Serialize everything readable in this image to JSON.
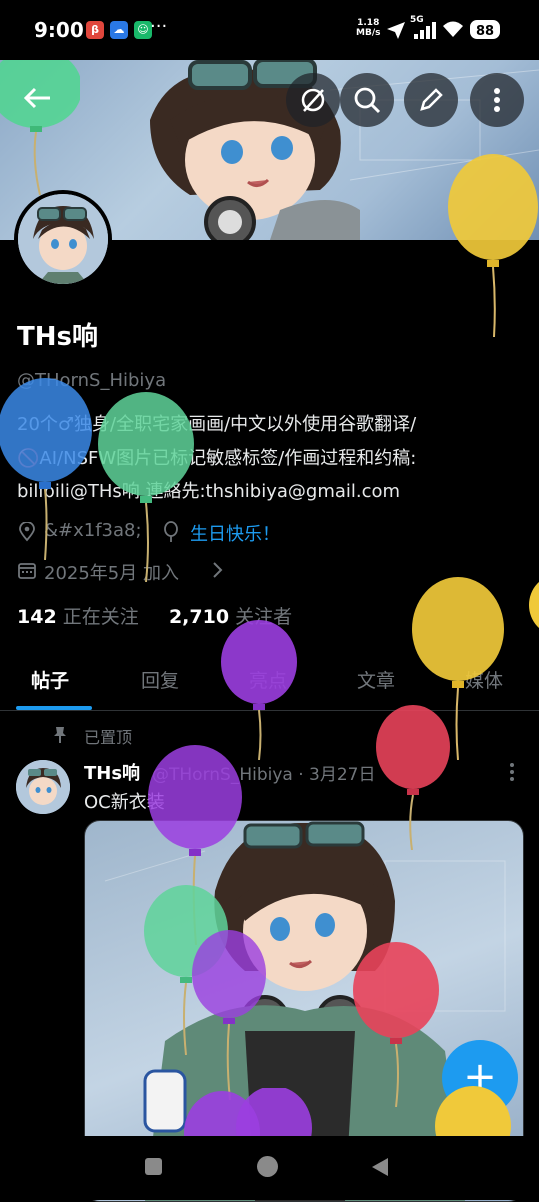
{
  "status_bar": {
    "time": "9:00",
    "apps": [
      "red-app",
      "cloud-app",
      "green-app"
    ],
    "more": "···",
    "net_speed_value": "1.18",
    "net_speed_unit": "MB/s",
    "network": "5G",
    "battery": "88"
  },
  "header": {
    "back_icon": "arrow-left-icon",
    "actions": [
      "grok-icon",
      "search-icon",
      "edit-icon",
      "more-vertical-icon"
    ]
  },
  "profile": {
    "display_name": "THs响",
    "handle": "@THornS_Hibiya",
    "bio_lines": [
      "20个♂独身/全职宅家画画/中文以外使用谷歌翻译/",
      "🚫AI/NSFW图片已标记敏感标签/作画过程和约稿:",
      "bilibili@THs响 連絡先:thshibiya@gmail.com"
    ],
    "location": "&#x1f3a8;",
    "birthday": "生日快乐！",
    "joined": "2025年5月 加入",
    "following_count": "142",
    "following_label": "正在关注",
    "followers_count": "2,710",
    "followers_label": "关注者"
  },
  "tabs": [
    {
      "label": "帖子",
      "active": true
    },
    {
      "label": "回复",
      "active": false
    },
    {
      "label": "亮点",
      "active": false
    },
    {
      "label": "文章",
      "active": false
    },
    {
      "label": "媒体",
      "active": false
    }
  ],
  "post": {
    "pinned_label": "已置顶",
    "author": "THs响",
    "meta": "@THornS_Hibiya · 3月27日",
    "text": "OC新衣装"
  },
  "colors": {
    "accent": "#1d9bf0",
    "background": "#000000",
    "secondary_text": "#71767b",
    "birthday": "#1d9bf0"
  },
  "balloon_colors": [
    "#4fd68f",
    "#f0c93a",
    "#3b8ae8",
    "#5fd49a",
    "#9b3ee0",
    "#e8435a"
  ]
}
